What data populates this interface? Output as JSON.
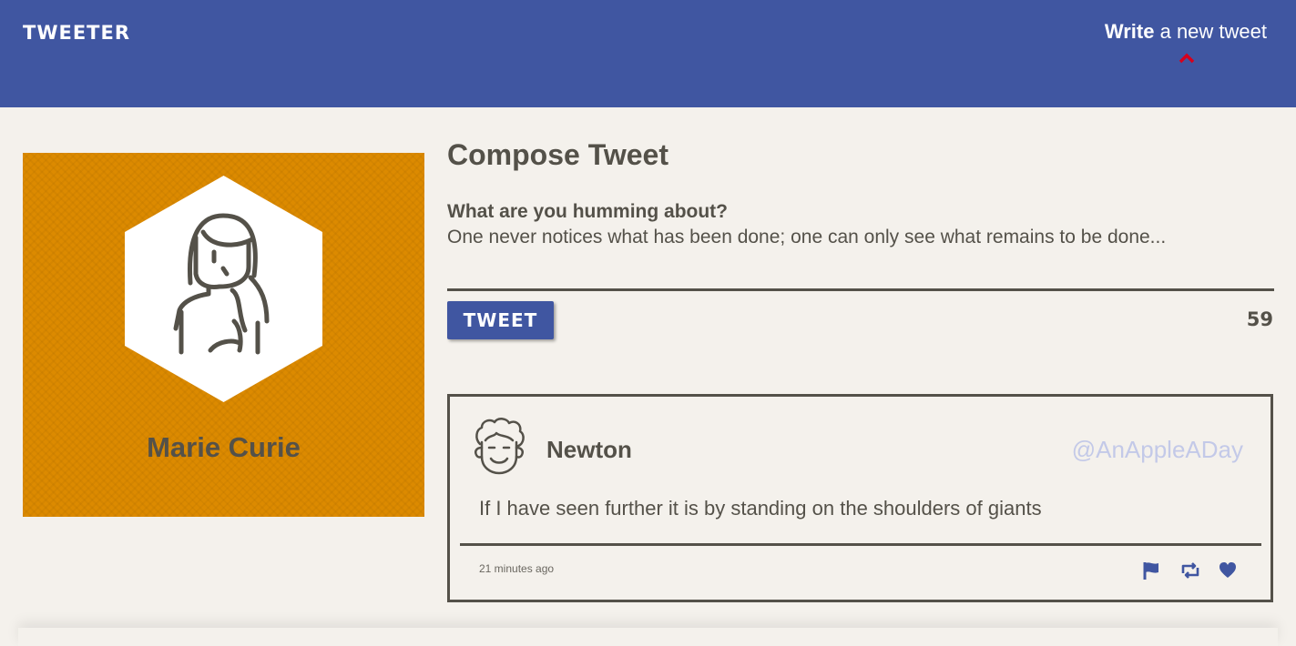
{
  "app": {
    "brand": "TWEETER",
    "accent_color": "#4056a1",
    "text_color": "#545149",
    "background_color": "#f4f1ec"
  },
  "nav": {
    "compose_strong": "Write",
    "compose_rest": " a new tweet",
    "chevron_icon": "chevron-up-icon",
    "chevron_color": "#d6001c"
  },
  "profile": {
    "name": "Marie Curie",
    "banner_color": "#dc8a00",
    "avatar_icon": "woman-avatar-icon"
  },
  "compose": {
    "title": "Compose Tweet",
    "label": "What are you humming about?",
    "textarea_value": "One never notices what has been done; one can only see what remains to be done...",
    "button_label": "TWEET",
    "counter": "59"
  },
  "tweet": {
    "name": "Newton",
    "handle": "@AnAppleADay",
    "content": "If I have seen further it is by standing on the shoulders of giants",
    "timestamp": "21 minutes ago",
    "avatar_icon": "curly-hair-man-avatar-icon",
    "action_icons": [
      "flag-icon",
      "retweet-icon",
      "heart-icon"
    ]
  }
}
